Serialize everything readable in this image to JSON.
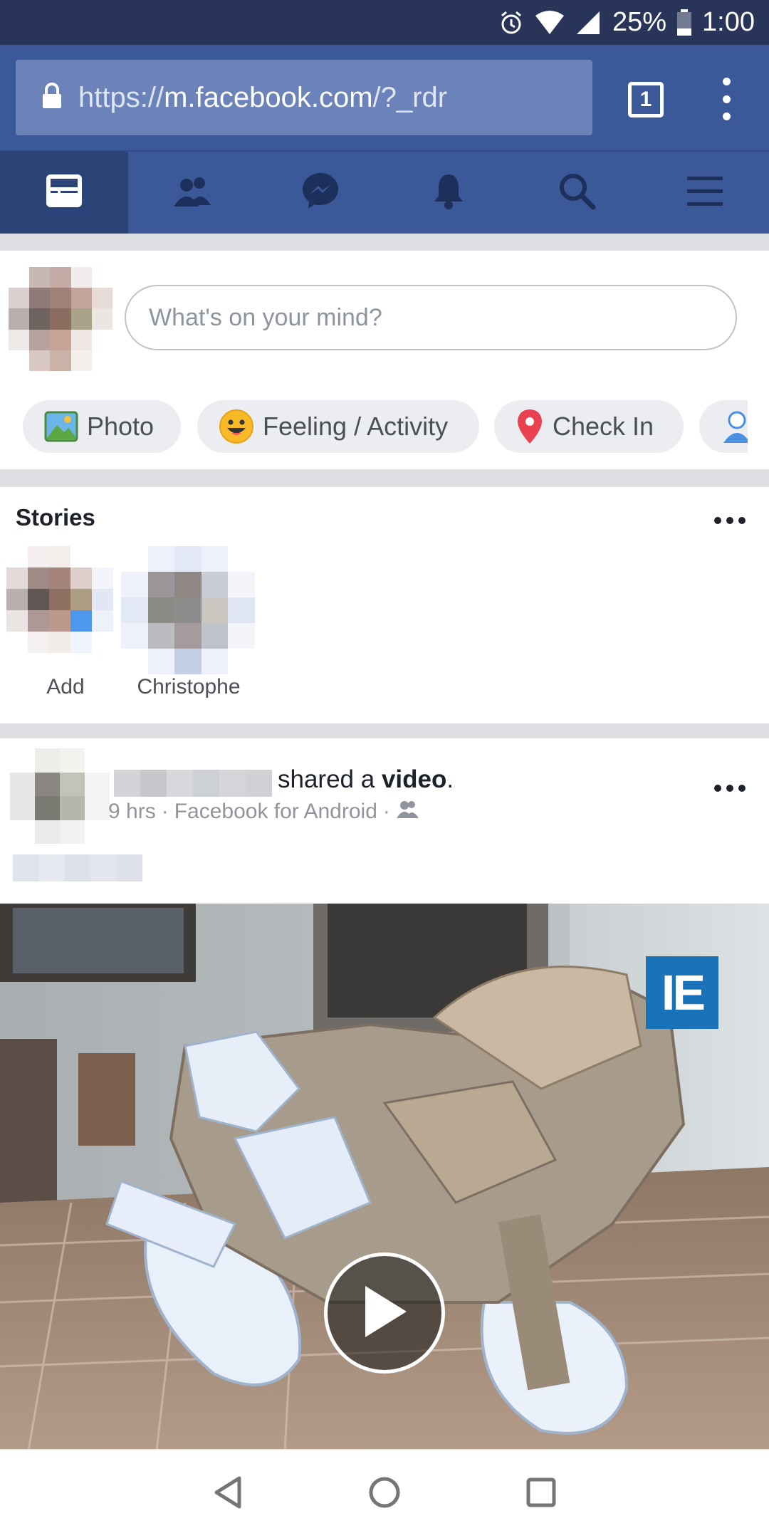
{
  "status_bar": {
    "battery": "25%",
    "time": "1:00"
  },
  "browser": {
    "url_scheme": "https://",
    "url_host": "m.facebook.com",
    "url_path": "/?_rdr",
    "tab_count": "1"
  },
  "nav": {
    "tabs": [
      "news-feed",
      "friends",
      "messenger",
      "notifications",
      "search",
      "menu"
    ],
    "active": "news-feed"
  },
  "composer": {
    "placeholder": "What's on your mind?",
    "actions": {
      "photo": "Photo",
      "feeling": "Feeling / Activity",
      "checkin": "Check In"
    }
  },
  "stories": {
    "title": "Stories",
    "items": [
      {
        "label": "Add"
      },
      {
        "label": "Christophe"
      }
    ]
  },
  "post": {
    "action_text": "shared a ",
    "action_object": "video",
    "action_end": ".",
    "time": "9 hrs",
    "source": "Facebook for Android",
    "separator": "·"
  },
  "colors": {
    "brand": "#3b5998",
    "brand_dark": "#2c4378",
    "status_bar": "#283559"
  }
}
